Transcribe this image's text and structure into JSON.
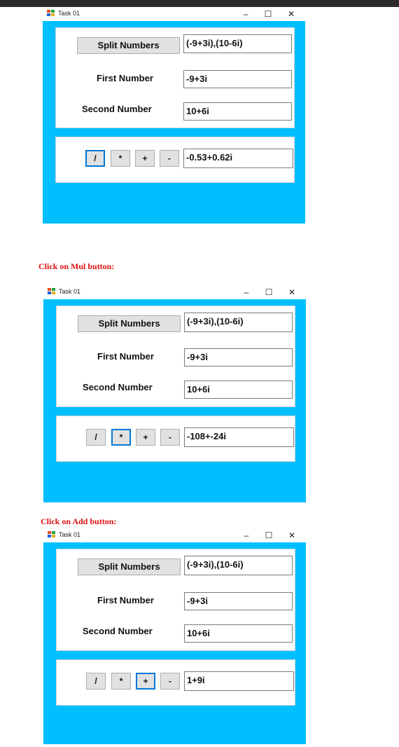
{
  "windows": [
    {
      "caption": "",
      "title": "Task 01",
      "controls": {
        "minimize": "–",
        "maximize": "☐",
        "close": "✕"
      },
      "split_button": "Split Numbers",
      "split_value": "(-9+3i),(10-6i)",
      "first_label": "First Number",
      "first_value": "-9+3i",
      "second_label": "Second Number",
      "second_value": "10+6i",
      "ops": [
        "/",
        "*",
        "+",
        "-"
      ],
      "active_op": "/",
      "result": "-0.53+0.62i"
    },
    {
      "caption": "Click on Mul button:",
      "title": "Task 01",
      "controls": {
        "minimize": "–",
        "maximize": "☐",
        "close": "✕"
      },
      "split_button": "Split Numbers",
      "split_value": "(-9+3i),(10-6i)",
      "first_label": "First Number",
      "first_value": "-9+3i",
      "second_label": "Second Number",
      "second_value": "10+6i",
      "ops": [
        "/",
        "*",
        "+",
        "-"
      ],
      "active_op": "*",
      "result": "-108+-24i"
    },
    {
      "caption": "Click on Add button:",
      "title": "Task 01",
      "controls": {
        "minimize": "–",
        "maximize": "☐",
        "close": "✕"
      },
      "split_button": "Split Numbers",
      "split_value": "(-9+3i),(10-6i)",
      "first_label": "First Number",
      "first_value": "-9+3i",
      "second_label": "Second Number",
      "second_value": "10+6i",
      "ops": [
        "/",
        "*",
        "+",
        "-"
      ],
      "active_op": "+",
      "result": "1+9i"
    }
  ],
  "colors": {
    "client_bg": "#00bfff",
    "caption": "#e01010",
    "focus_border": "#0078d7"
  }
}
